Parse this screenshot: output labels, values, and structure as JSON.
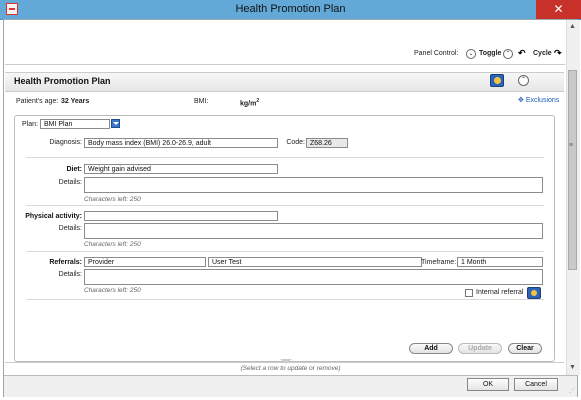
{
  "window": {
    "title": "Health Promotion Plan",
    "close_glyph": "✕"
  },
  "panel_control": {
    "label": "Panel Control:",
    "toggle_label": "Toggle",
    "cycle_label": "Cycle"
  },
  "header": {
    "title": "Health Promotion Plan"
  },
  "patient": {
    "age_label": "Patient's age:",
    "age_value": "32 Years",
    "bmi_label": "BMI:",
    "bmi_unit": "kg/m",
    "bmi_unit_sup": "2"
  },
  "exclusions_label": "Exclusions",
  "plan": {
    "plan_label": "Plan:",
    "plan_value": "BMI Plan",
    "diagnosis_label": "Diagnosis:",
    "diagnosis_value": "Body mass index (BMI) 26.0-26.9, adult",
    "code_label": "Code:",
    "code_value": "Z68.26"
  },
  "diet": {
    "label": "Diet:",
    "value": "Weight gain advised",
    "details_label": "Details:",
    "chars_left": "Characters left: 250"
  },
  "physical_activity": {
    "label": "Physical activity:",
    "value": "",
    "details_label": "Details:",
    "chars_left": "Characters left: 250"
  },
  "referrals": {
    "label": "Referrals:",
    "value1": "Provider",
    "value2": "User Test",
    "timeframe_label": "Timeframe:",
    "timeframe_value": "1 Month",
    "details_label": "Details:",
    "chars_left": "Characters left: 250",
    "internal_referral_label": "Internal referral"
  },
  "actions": {
    "add": "Add",
    "update": "Update",
    "clear": "Clear"
  },
  "hint": "(Select a row to update or remove)",
  "footer": {
    "ok": "OK",
    "cancel": "Cancel"
  }
}
